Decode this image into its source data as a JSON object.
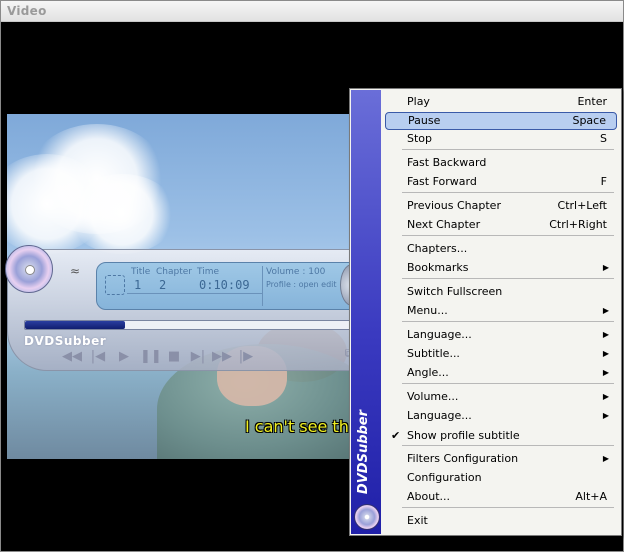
{
  "window": {
    "title": "Video"
  },
  "video": {
    "subtitle": "I can't see th"
  },
  "player": {
    "brand": "DVDSubber",
    "lcd": {
      "title_label": "Title",
      "chapter_label": "Chapter",
      "time_label": "Time",
      "title_value": "1",
      "chapter_value": "2",
      "time_value": "0:10:09",
      "volume_text": "Volume : 100",
      "profile_text": "Profile : open edit"
    },
    "seek_progress": 0.3,
    "controls": [
      {
        "name": "fast-backward-button",
        "glyph": "◀◀"
      },
      {
        "name": "previous-chapter-button",
        "glyph": "|◀"
      },
      {
        "name": "play-button",
        "glyph": "▶"
      },
      {
        "name": "pause-button",
        "glyph": "❚❚"
      },
      {
        "name": "stop-button",
        "glyph": "■"
      },
      {
        "name": "next-chapter-button",
        "glyph": "▶|"
      },
      {
        "name": "fast-forward-button",
        "glyph": "▶▶"
      },
      {
        "name": "step-button",
        "glyph": "|▶"
      }
    ]
  },
  "menu": {
    "side_brand": "DVDSubber",
    "items": [
      {
        "label": "Play",
        "shortcut": "Enter"
      },
      {
        "label": "Pause",
        "shortcut": "Space",
        "selected": true
      },
      {
        "label": "Stop",
        "shortcut": "S"
      },
      {
        "label": "Fast Backward",
        "shortcut": ""
      },
      {
        "label": "Fast Forward",
        "shortcut": "F"
      },
      {
        "label": "Previous Chapter",
        "shortcut": "Ctrl+Left"
      },
      {
        "label": "Next Chapter",
        "shortcut": "Ctrl+Right"
      },
      {
        "label": "Chapters...",
        "shortcut": ""
      },
      {
        "label": "Bookmarks",
        "submenu": true
      },
      {
        "label": "Switch Fullscreen",
        "shortcut": ""
      },
      {
        "label": "Menu...",
        "submenu": true
      },
      {
        "label": "Language...",
        "submenu": true
      },
      {
        "label": "Subtitle...",
        "submenu": true
      },
      {
        "label": "Angle...",
        "submenu": true
      },
      {
        "label": "Volume...",
        "submenu": true
      },
      {
        "label": "Language...",
        "submenu": true
      },
      {
        "label": "Show profile subtitle",
        "checked": true
      },
      {
        "label": "Filters Configuration",
        "submenu": true
      },
      {
        "label": "Configuration",
        "shortcut": ""
      },
      {
        "label": "About...",
        "shortcut": "Alt+A"
      },
      {
        "label": "Exit",
        "shortcut": ""
      }
    ]
  }
}
